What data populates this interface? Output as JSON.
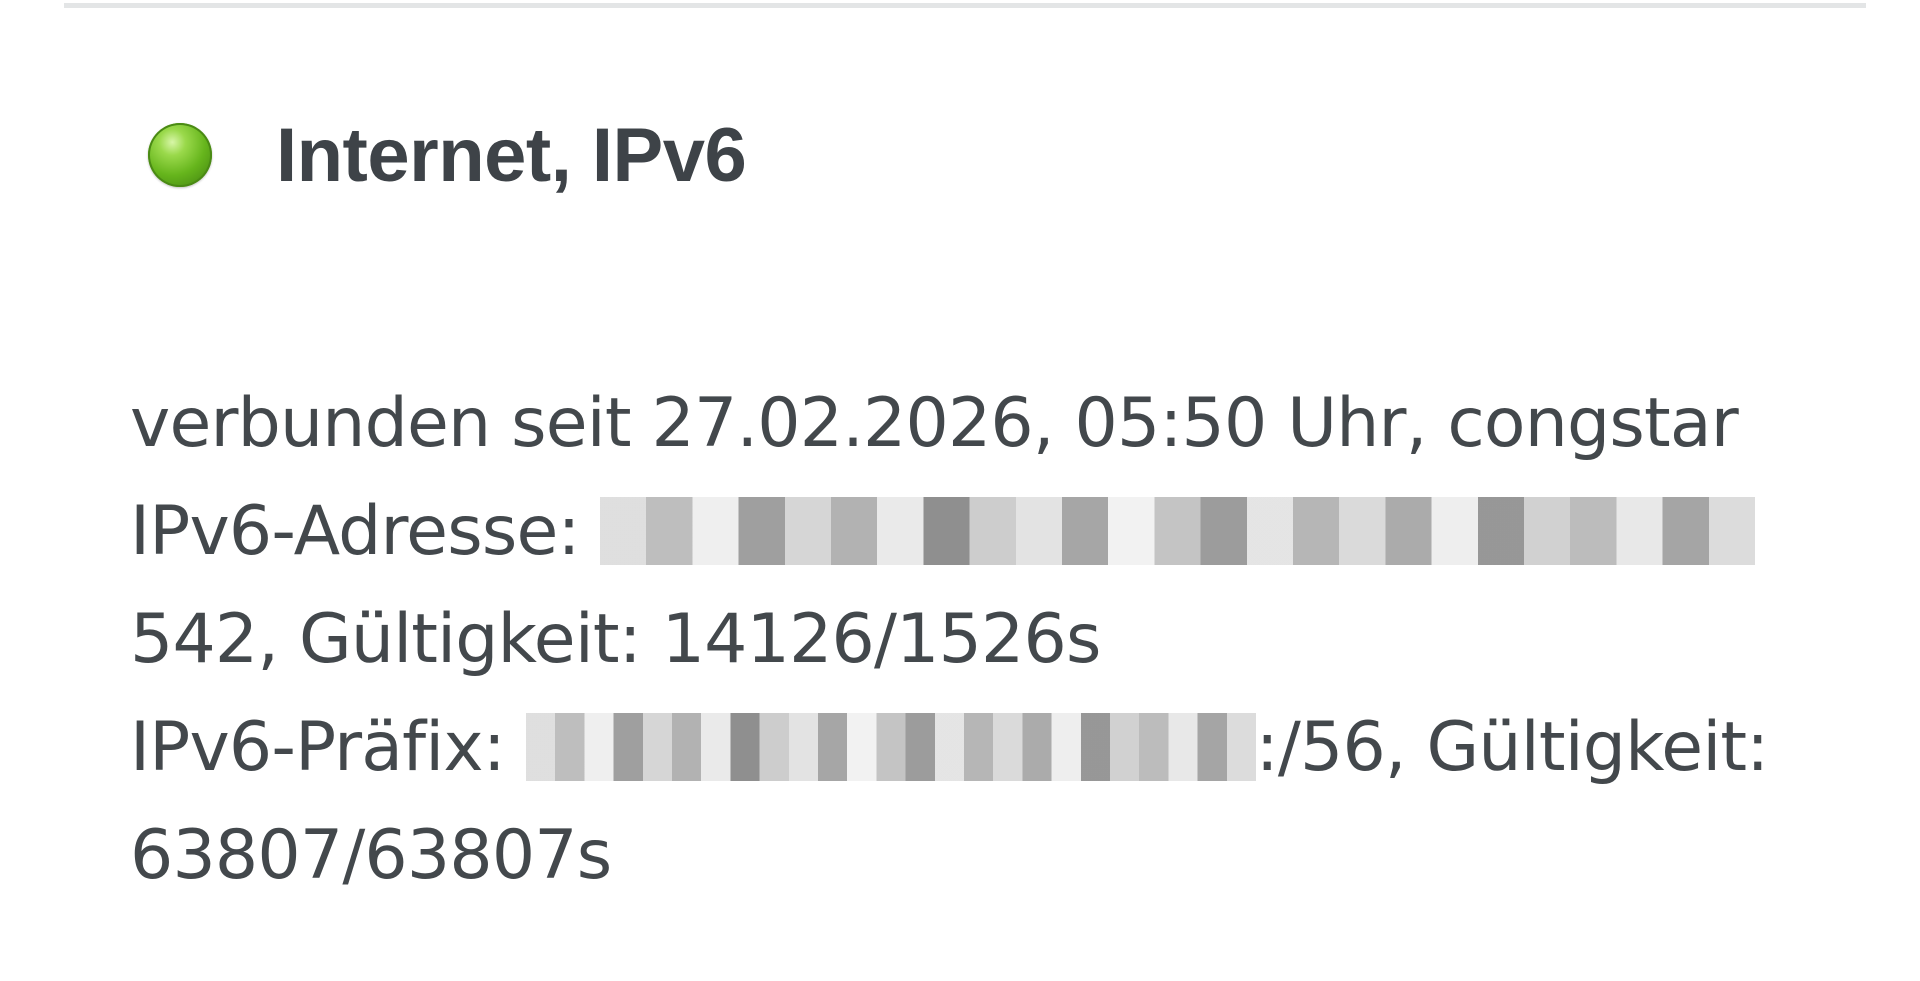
{
  "status": {
    "title": "Internet, IPv6",
    "indicator": "green-led-icon",
    "indicator_color": "#6ab51f"
  },
  "details": {
    "connection_line": "verbunden seit 27.02.2026, 05:50 Uhr, congstar",
    "address_label": "IPv6-Adresse:",
    "address_tail": "542, Gültigkeit: 14126/1526s",
    "prefix_label": "IPv6-Präfix:",
    "prefix_suffix": ":/56, Gültigkeit:",
    "prefix_validity": "63807/63807s"
  }
}
